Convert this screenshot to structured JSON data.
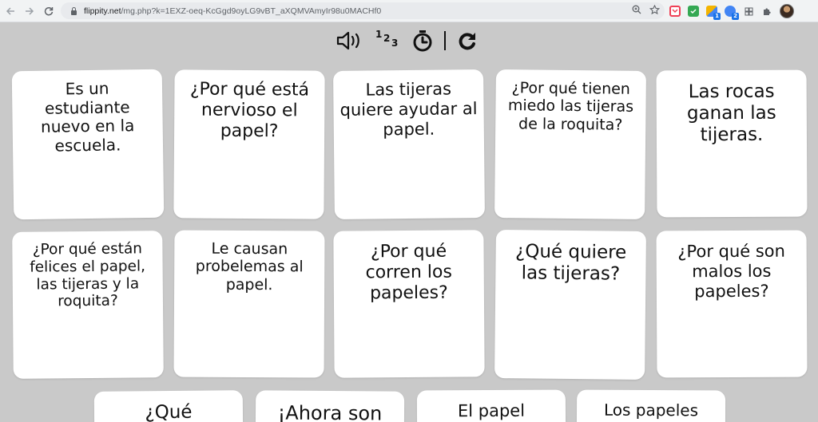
{
  "browser": {
    "url_domain": "flippity.net",
    "url_path": "/mg.php?k=1EXZ-oeq-KcGgd9oyLG9vBT_aXQMVAmyIr98u0MACHf0",
    "extensions": [
      {
        "name": "pocket-icon",
        "badge": ""
      },
      {
        "name": "green-extension-icon",
        "badge": ""
      },
      {
        "name": "multicolor-extension-icon",
        "badge": "1"
      },
      {
        "name": "starburst-extension-icon",
        "badge": "2"
      }
    ]
  },
  "toolbar": {
    "numbers_top": "1",
    "numbers_mid": "2",
    "numbers_bottom": "3"
  },
  "cards": [
    {
      "text": "Es un estudiante nuevo en la escuela."
    },
    {
      "text": "¿Por qué está nervioso el papel?"
    },
    {
      "text": "Las tijeras quiere ayudar al papel."
    },
    {
      "text": "¿Por qué tienen miedo las tijeras de la roquita?"
    },
    {
      "text": "Las rocas ganan las tijeras."
    },
    {
      "text": "¿Por qué están felices el papel, las tijeras y la roquita?"
    },
    {
      "text": "Le causan probelemas al papel."
    },
    {
      "text": "¿Por qué corren los papeles?"
    },
    {
      "text": "¿Qué quiere las tijeras?"
    },
    {
      "text": "¿Por qué son malos los papeles?"
    },
    {
      "text": "¿Qué"
    },
    {
      "text": "¡Ahora son"
    },
    {
      "text": "El papel"
    },
    {
      "text": "Los papeles"
    }
  ]
}
